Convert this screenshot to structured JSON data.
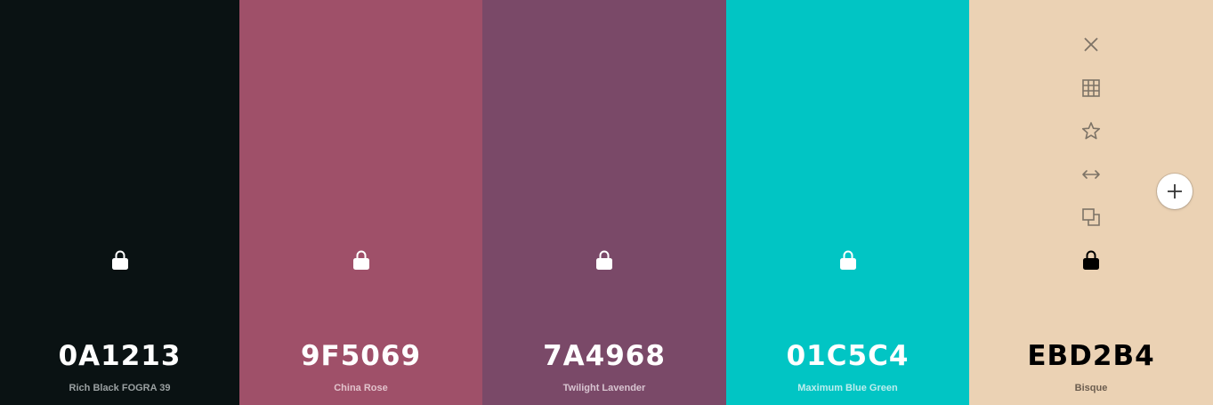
{
  "swatches": [
    {
      "hex": "0A1213",
      "name": "Rich Black FOGRA 39",
      "bg": "#0A1213",
      "text_color": "#ffffff",
      "name_color": "#9aa0a1",
      "lock_color": "#ffffff"
    },
    {
      "hex": "9F5069",
      "name": "China Rose",
      "bg": "#9F5069",
      "text_color": "#ffffff",
      "name_color": "#e2c3cc",
      "lock_color": "#ffffff"
    },
    {
      "hex": "7A4968",
      "name": "Twilight Lavender",
      "bg": "#7A4968",
      "text_color": "#ffffff",
      "name_color": "#d8c5d1",
      "lock_color": "#ffffff"
    },
    {
      "hex": "01C5C4",
      "name": "Maximum Blue Green",
      "bg": "#01C5C4",
      "text_color": "#ffffff",
      "name_color": "#bdeeee",
      "lock_color": "#ffffff"
    },
    {
      "hex": "EBD2B4",
      "name": "Bisque",
      "bg": "#EBD2B4",
      "text_color": "#000000",
      "name_color": "#6b5d4f",
      "lock_color": "#000000"
    }
  ],
  "toolbar": {
    "icons": [
      "close-icon",
      "grid-icon",
      "star-icon",
      "arrows-horizontal-icon",
      "copy-icon",
      "lock-icon"
    ],
    "icon_color": "#7d7366"
  },
  "add_button": {
    "icon": "plus-icon",
    "color": "#333333"
  }
}
